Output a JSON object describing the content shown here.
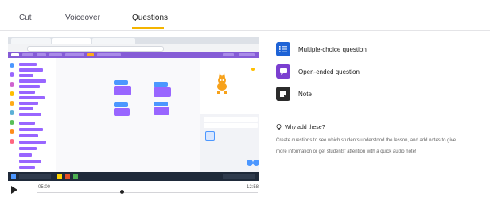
{
  "tabs": [
    {
      "label": "Cut"
    },
    {
      "label": "Voiceover"
    },
    {
      "label": "Questions"
    }
  ],
  "player": {
    "current_time": "05:00",
    "total_time": "12:58",
    "progress": 0.385
  },
  "add_items": [
    {
      "label": "Multiple-choice question",
      "icon": "list-icon",
      "color": "#1e63d6"
    },
    {
      "label": "Open-ended question",
      "icon": "speech-bubble-icon",
      "color": "#7b3fd0"
    },
    {
      "label": "Note",
      "icon": "note-icon",
      "color": "#2b2b2b"
    }
  ],
  "info": {
    "title": "Why add these?",
    "text": "Create questions to see which students understood the lesson, and add notes to give more information or get students' attention with a quick audio note!"
  },
  "colors": {
    "accent": "#f4b400",
    "scratch_purple": "#855cd6"
  }
}
